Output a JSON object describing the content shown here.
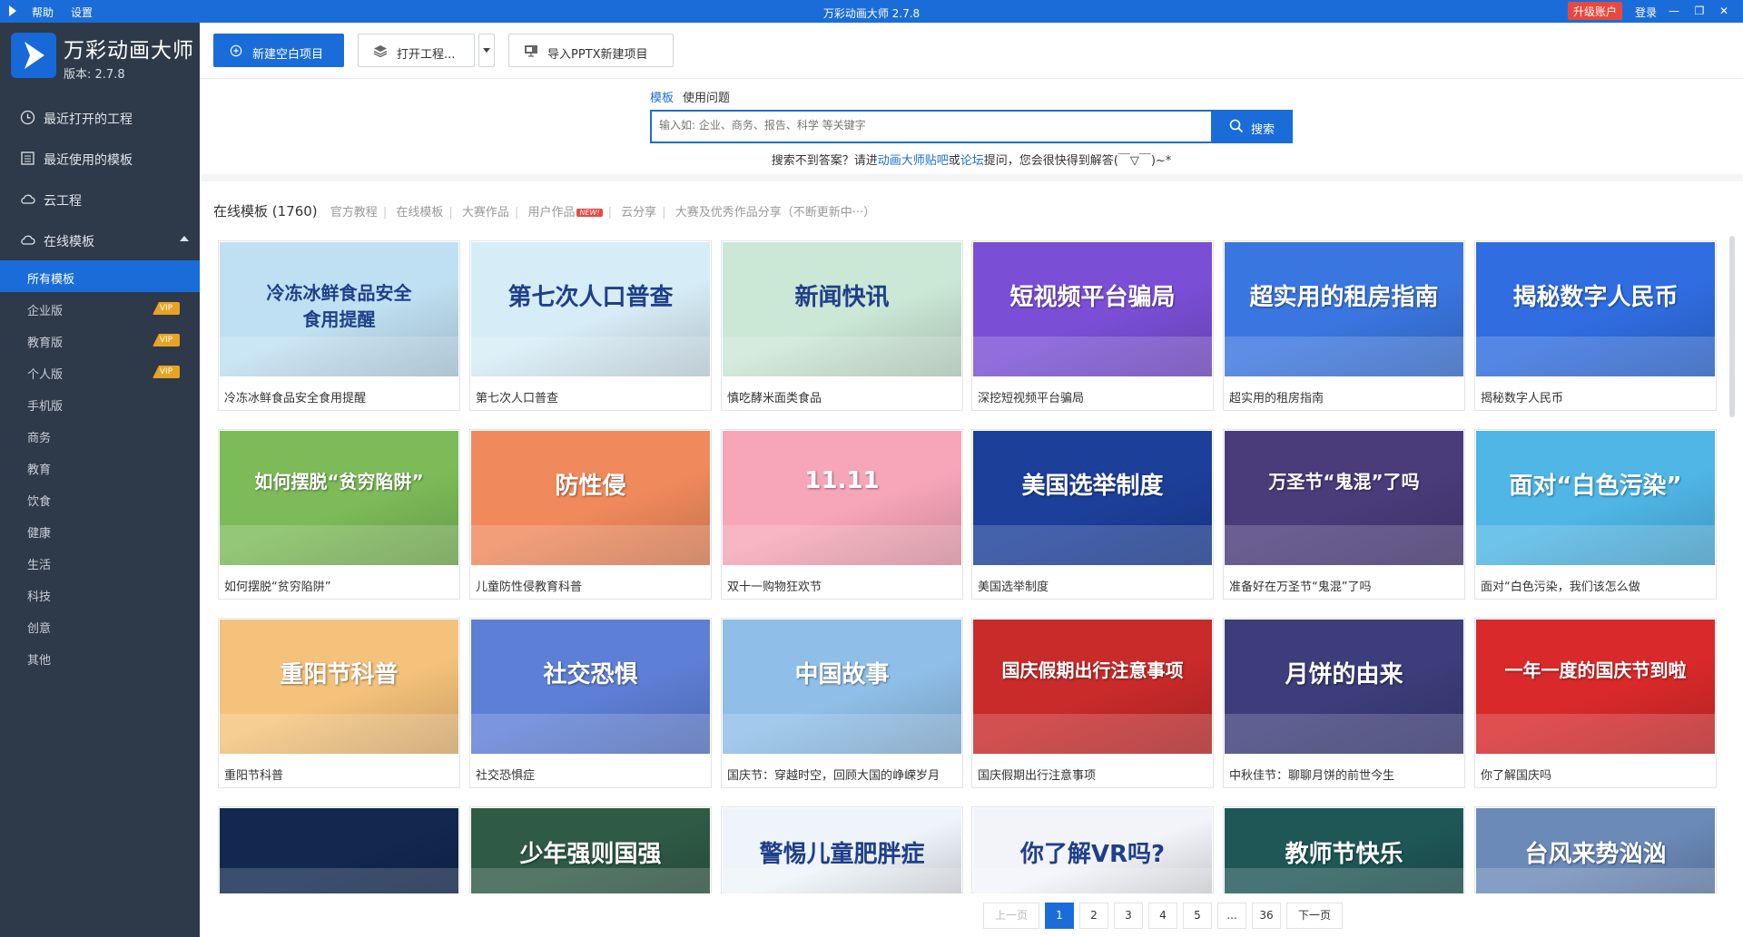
{
  "titlebar": {
    "menu_help": "帮助",
    "menu_settings": "设置",
    "title": "万彩动画大师 2.7.8",
    "upgrade": "升级账户",
    "login": "登录",
    "minimize": "—",
    "maximize": "❐",
    "close": "✕"
  },
  "sidebar": {
    "app_name": "万彩动画大师",
    "version": "版本: 2.7.8",
    "nav": [
      {
        "label": "最近打开的工程",
        "icon": "clock-icon"
      },
      {
        "label": "最近使用的模板",
        "icon": "template-icon"
      },
      {
        "label": "云工程",
        "icon": "cloud-icon"
      },
      {
        "label": "在线模板",
        "icon": "cloud-icon"
      }
    ],
    "sub": [
      {
        "label": "所有模板",
        "vip": ""
      },
      {
        "label": "企业版",
        "vip": "VIP"
      },
      {
        "label": "教育版",
        "vip": "VIP"
      },
      {
        "label": "个人版",
        "vip": "VIP"
      },
      {
        "label": "手机版",
        "vip": ""
      },
      {
        "label": "商务",
        "vip": ""
      },
      {
        "label": "教育",
        "vip": ""
      },
      {
        "label": "饮食",
        "vip": ""
      },
      {
        "label": "健康",
        "vip": ""
      },
      {
        "label": "生活",
        "vip": ""
      },
      {
        "label": "科技",
        "vip": ""
      },
      {
        "label": "创意",
        "vip": ""
      },
      {
        "label": "其他",
        "vip": ""
      }
    ]
  },
  "toolbar": {
    "new_blank": "新建空白项目",
    "open_project": "打开工程...",
    "import_pptx": "导入PPTX新建项目"
  },
  "search": {
    "tab_template": "模板",
    "tab_help": "使用问题",
    "placeholder": "输入如: 企业、商务、报告、科学 等关键字",
    "button": "搜索",
    "hint_pre": "搜索不到答案？请进",
    "hint_link1": "动画大师贴吧",
    "hint_mid": "或",
    "hint_link2": "论坛",
    "hint_post": "提问，您会很快得到解答(￣▽￣)~*"
  },
  "filters": {
    "title": "在线模板 (1760)",
    "items": [
      "官方教程",
      "在线模板",
      "大赛作品",
      "用户作品",
      "云分享",
      "大赛及优秀作品分享（不断更新中···）"
    ],
    "new_badge": "NEW!"
  },
  "colors": {
    "accent": "#1a6dd8",
    "sidebar": "#2e3949",
    "vip": "#e9a324"
  },
  "cards": [
    {
      "caption": "冷冻冰鲜食品安全食用提醒",
      "text": "冷冻冰鲜食品安全\n食用提醒",
      "bg": "#bfe0f2"
    },
    {
      "caption": "第七次人口普查",
      "text": "第七次人口普查",
      "bg": "#d6ecf6"
    },
    {
      "caption": "慎吃酵米面类食品",
      "text": "新闻快讯",
      "bg": "#cbe7d6"
    },
    {
      "caption": "深挖短视频平台骗局",
      "text": "短视频平台骗局",
      "bg": "#7a4fd6"
    },
    {
      "caption": "超实用的租房指南",
      "text": "超实用的租房指南",
      "bg": "#3a76e0"
    },
    {
      "caption": "揭秘数字人民币",
      "text": "揭秘数字人民币",
      "bg": "#2f6de0"
    },
    {
      "caption": "如何摆脱“贫穷陷阱”",
      "text": "如何摆脱“贫穷陷阱”",
      "bg": "#7dbb58"
    },
    {
      "caption": "儿童防性侵教育科普",
      "text": "防性侵",
      "bg": "#f08a5c"
    },
    {
      "caption": "双十一购物狂欢节",
      "text": "11.11",
      "bg": "#f7a6b8"
    },
    {
      "caption": "美国选举制度",
      "text": "美国选举制度",
      "bg": "#1c3f9a"
    },
    {
      "caption": "准备好在万圣节“鬼混”了吗",
      "text": "万圣节“鬼混”了吗",
      "bg": "#4a3b7a"
    },
    {
      "caption": "面对“白色污染，我们该怎么做",
      "text": "面对“白色污染”",
      "bg": "#4fb6e6"
    },
    {
      "caption": "重阳节科普",
      "text": "重阳节科普",
      "bg": "#f4c27a"
    },
    {
      "caption": "社交恐惧症",
      "text": "社交恐惧",
      "bg": "#5e7fd6"
    },
    {
      "caption": "国庆节：穿越时空，回顾大国的峥嵘岁月",
      "text": "中国故事",
      "bg": "#8fbfe8"
    },
    {
      "caption": "国庆假期出行注意事项",
      "text": "国庆假期出行注意事项",
      "bg": "#c92a2a"
    },
    {
      "caption": "中秋佳节：聊聊月饼的前世今生",
      "text": "月饼的由来",
      "bg": "#3c3d7a"
    },
    {
      "caption": "你了解国庆吗",
      "text": "一年一度的国庆节到啦",
      "bg": "#d9292a"
    },
    {
      "caption": "",
      "text": "",
      "bg": "#12284f"
    },
    {
      "caption": "",
      "text": "少年强则国强",
      "bg": "#2f5a46"
    },
    {
      "caption": "",
      "text": "警惕儿童肥胖症",
      "bg": "#eef4fa"
    },
    {
      "caption": "",
      "text": "你了解VR吗?",
      "bg": "#f3f4fa"
    },
    {
      "caption": "",
      "text": "教师节快乐",
      "bg": "#1f5757"
    },
    {
      "caption": "",
      "text": "台风来势汹汹",
      "bg": "#6b8ab8"
    }
  ],
  "pager": {
    "prev": "上一页",
    "pages": [
      "1",
      "2",
      "3",
      "4",
      "5",
      "...",
      "36"
    ],
    "next": "下一页",
    "current": "1"
  }
}
